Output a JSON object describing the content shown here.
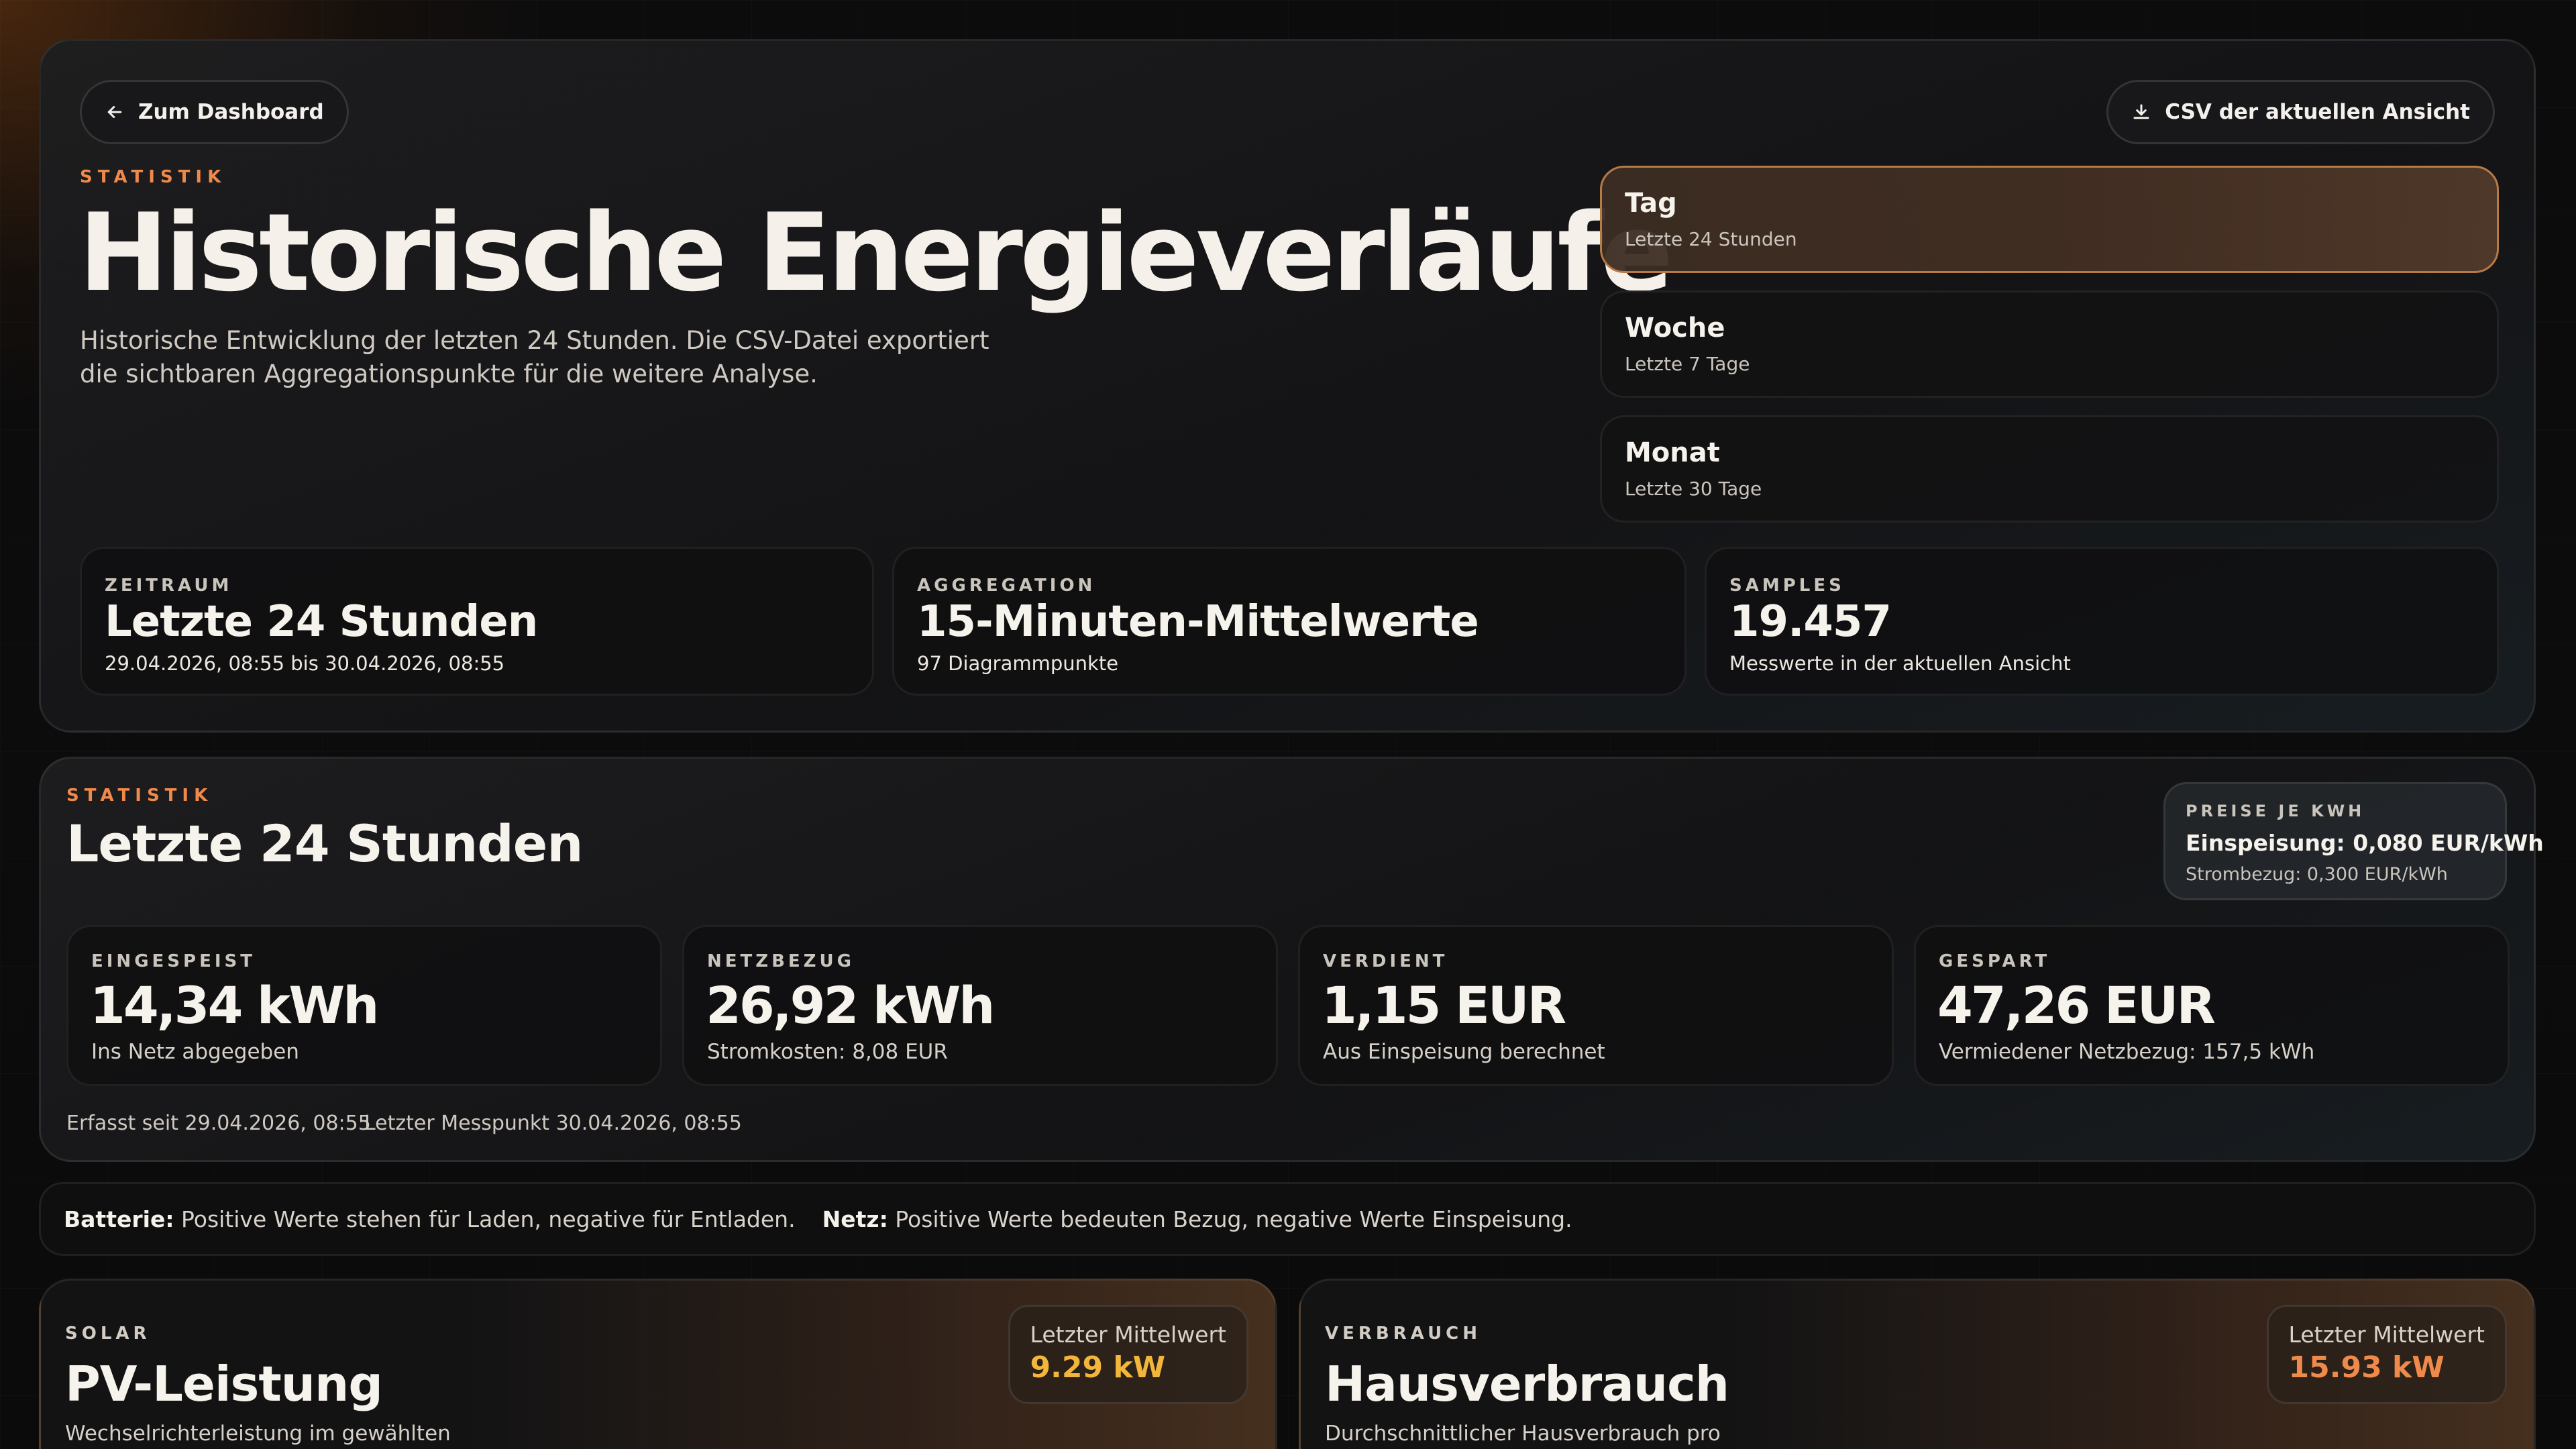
{
  "header": {
    "back_label": "Zum Dashboard",
    "csv_label": "CSV der aktuellen Ansicht",
    "eyebrow": "Statistik",
    "title": "Historische Energieverläufe",
    "description": "Historische Entwicklung der letzten 24 Stunden. Die CSV-Datei exportiert die sichtbaren Aggregationspunkte für die weitere Analyse."
  },
  "ranges": [
    {
      "label": "Tag",
      "sub": "Letzte 24 Stunden",
      "active": true
    },
    {
      "label": "Woche",
      "sub": "Letzte 7 Tage",
      "active": false
    },
    {
      "label": "Monat",
      "sub": "Letzte 30 Tage",
      "active": false
    }
  ],
  "info_cards": [
    {
      "label": "Zeitraum",
      "value": "Letzte 24 Stunden",
      "sub": "29.04.2026, 08:55 bis 30.04.2026, 08:55"
    },
    {
      "label": "Aggregation",
      "value": "15-Minuten-Mittelwerte",
      "sub": "97 Diagrammpunkte"
    },
    {
      "label": "Samples",
      "value": "19.457",
      "sub": "Messwerte in der aktuellen Ansicht"
    }
  ],
  "stats": {
    "eyebrow": "Statistik",
    "title": "Letzte 24 Stunden",
    "prices": {
      "label": "PREISE JE KWH",
      "feed_in": "Einspeisung: 0,080 EUR/kWh",
      "grid": "Strombezug: 0,300 EUR/kWh"
    },
    "cards": [
      {
        "label": "Eingespeist",
        "value": "14,34 kWh",
        "sub": "Ins Netz abgegeben"
      },
      {
        "label": "Netzbezug",
        "value": "26,92 kWh",
        "sub": "Stromkosten: 8,08 EUR"
      },
      {
        "label": "Verdient",
        "value": "1,15 EUR",
        "sub": "Aus Einspeisung berechnet"
      },
      {
        "label": "Gespart",
        "value": "47,26 EUR",
        "sub": "Vermiedener Netzbezug: 157,5 kWh"
      }
    ],
    "recorded_since": "Erfasst seit 29.04.2026, 08:55",
    "last_point": "Letzter Messpunkt 30.04.2026, 08:55"
  },
  "legend": {
    "battery_label": "Batterie:",
    "battery_text": "Positive Werte stehen für Laden, negative für Entladen.",
    "grid_label": "Netz:",
    "grid_text": "Positive Werte bedeuten Bezug, negative Werte Einspeisung."
  },
  "charts": [
    {
      "eyebrow": "SOLAR",
      "title": "PV-Leistung",
      "sub": "Wechselrichterleistung im gewählten",
      "last_label": "Letzter Mittelwert",
      "last_value": "9.29 kW",
      "color": "#f2b63a"
    },
    {
      "eyebrow": "VERBRAUCH",
      "title": "Hausverbrauch",
      "sub": "Durchschnittlicher Hausverbrauch pro",
      "last_label": "Letzter Mittelwert",
      "last_value": "15.93 kW",
      "color": "#f08a4b"
    }
  ],
  "colors": {
    "accent": "#f08a4b",
    "solar": "#f2b63a",
    "active_border": "#b77a45"
  }
}
